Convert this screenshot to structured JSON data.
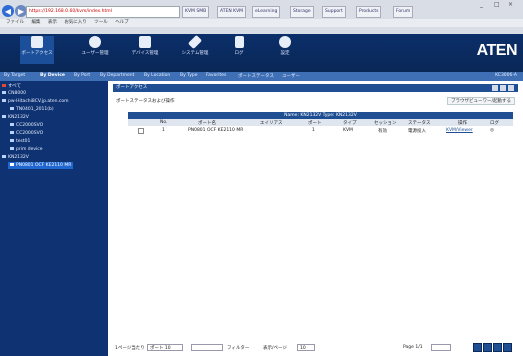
{
  "browser": {
    "address": "https://192.168.0.60/kvm/index.html",
    "tabs": [
      "KVM SMB",
      "ATEN KVM",
      "eLearning",
      "Storage",
      "Support",
      "Products",
      "Forum"
    ],
    "menu": [
      "ファイル",
      "編集",
      "表示",
      "お気に入り",
      "ツール",
      "ヘルプ"
    ],
    "window_controls": [
      "_",
      "□",
      "×"
    ]
  },
  "toolbar": {
    "items": [
      {
        "label": "ポートアクセス",
        "icon": "port-access-icon"
      },
      {
        "label": "ユーザー管理",
        "icon": "user-icon"
      },
      {
        "label": "デバイス管理",
        "icon": "device-icon"
      },
      {
        "label": "システム管理",
        "icon": "tools-icon"
      },
      {
        "label": "ログ",
        "icon": "log-icon"
      },
      {
        "label": "設定",
        "icon": "gear-icon"
      }
    ],
    "brand": "ATEN",
    "session": "KC3006-A"
  },
  "subnav": [
    "By Target",
    "By Device",
    "By Port",
    "By Department",
    "By Location",
    "By Type",
    "Favorites",
    "ポートステータス",
    "ユーザー"
  ],
  "tree": [
    {
      "label": "すべて",
      "indent": 0,
      "selected": false
    },
    {
      "label": "CN8000",
      "indent": 0,
      "selected": false
    },
    {
      "label": "pw-Hitachi8CV.jp.aten.com",
      "indent": 0,
      "selected": false
    },
    {
      "label": "TN0401_2011(b)",
      "indent": 1,
      "selected": false
    },
    {
      "label": "KN2132V",
      "indent": 0,
      "selected": false
    },
    {
      "label": "CC2000SVO",
      "indent": 1,
      "selected": false
    },
    {
      "label": "CC2000SVO",
      "indent": 1,
      "selected": false
    },
    {
      "label": "test01",
      "indent": 1,
      "selected": false
    },
    {
      "label": "prim device",
      "indent": 1,
      "selected": false
    },
    {
      "label": "KN2132V",
      "indent": 0,
      "selected": false
    },
    {
      "label": "PN0801 OCF KE2110 MR",
      "indent": 1,
      "selected": true
    }
  ],
  "panel": {
    "title": "ポートアクセス",
    "section_title": "ポートステータスおよび操作",
    "viewer_link": "ブラウザビューワー/起動する",
    "info": "Name: KN2132V   Type: KN2132V",
    "columns": [
      "No.",
      "ポート名",
      "エイリアス",
      "ポート",
      "タイプ",
      "セッション",
      "ステータス",
      "操作",
      "ログ"
    ],
    "rows": [
      {
        "no": "1",
        "name": "PN0801 OCF KE2110 MR",
        "alias": "",
        "port": "1",
        "type": "KVM",
        "session": "有効",
        "status": "電源投入",
        "action": "KVM/Viewer",
        "log": "◎"
      }
    ]
  },
  "footer": {
    "display_label": "1ページ当たり",
    "display_value": "ポート 10",
    "filter_label": "フィルター",
    "per_page_label": "表示/ページ",
    "per_page_value": "10",
    "page_text": "Page 1/1"
  }
}
